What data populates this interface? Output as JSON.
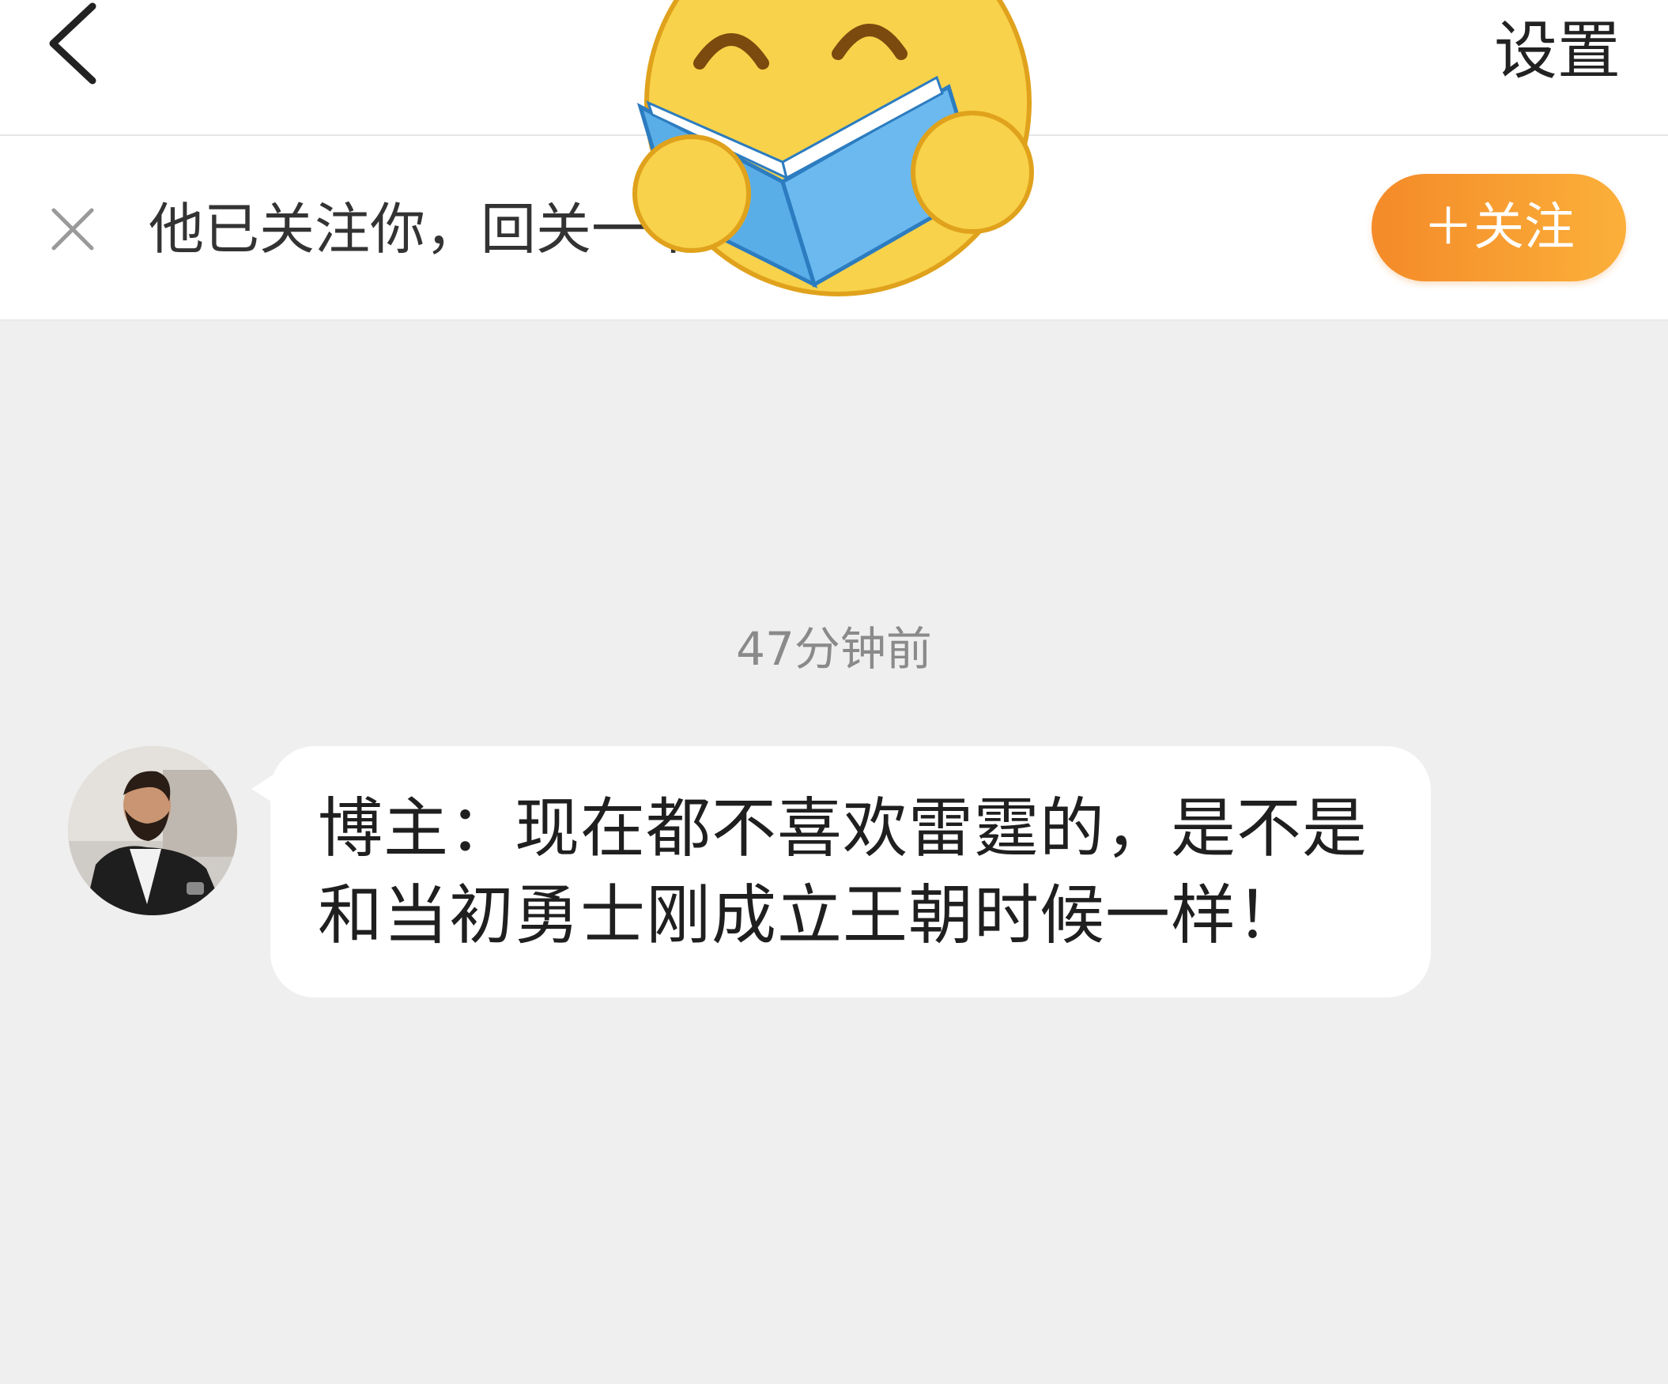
{
  "nav": {
    "back_icon": "chevron-left-icon",
    "settings_label": "设置"
  },
  "banner": {
    "close_icon": "close-icon",
    "text": "他已关注你，回关一下吧",
    "follow_label": "＋关注"
  },
  "sticker": {
    "icon": "emoji-reading-book-sticker"
  },
  "chat": {
    "timestamp": "47分钟前",
    "messages": [
      {
        "avatar": "user-avatar-photo",
        "text": "博主：现在都不喜欢雷霆的，是不是和当初勇士刚成立王朝时候一样！"
      }
    ]
  },
  "colors": {
    "background": "#efefef",
    "accent_orange": "#f48a28",
    "accent_orange_light": "#fbb03a",
    "text_dark": "#1f1f1f",
    "text_gray": "#8a8a8a"
  }
}
